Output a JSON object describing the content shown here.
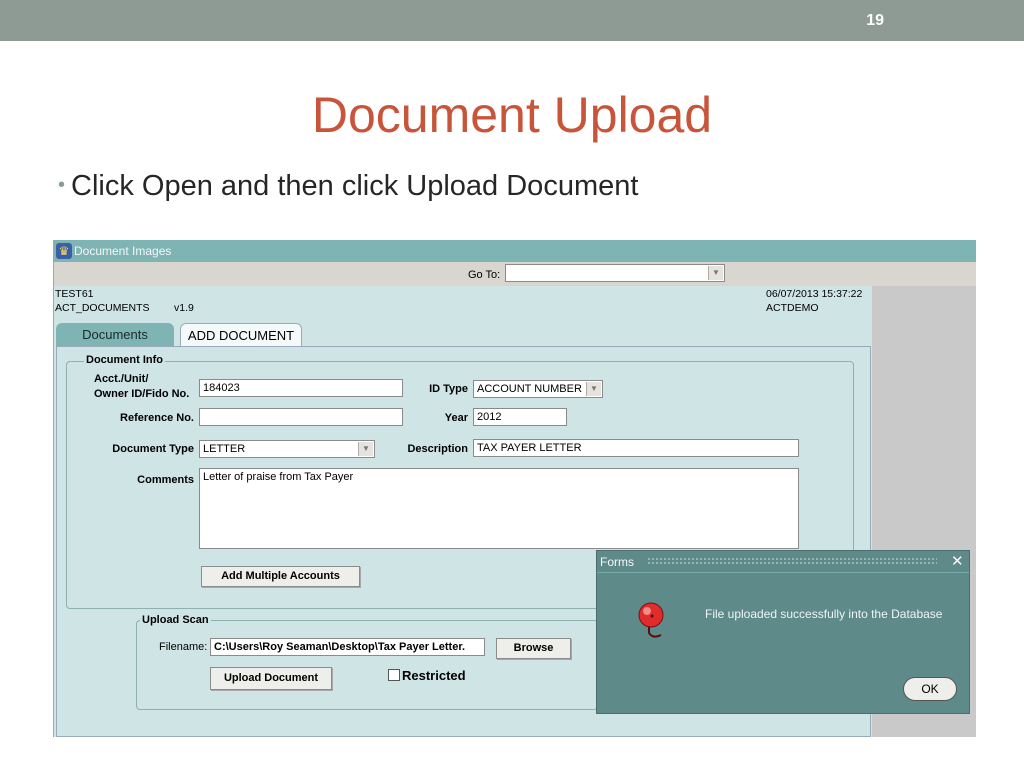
{
  "slide": {
    "number": "19",
    "title": "Document Upload",
    "bullet": "Click Open and then click Upload Document"
  },
  "window": {
    "title": "Document Images",
    "goto_label": "Go To:",
    "goto_value": "",
    "code_left_1": "TEST61",
    "code_left_2": "ACT_DOCUMENTS",
    "version": "v1.9",
    "datetime": "06/07/2013 15:37:22",
    "env": "ACTDEMO"
  },
  "tabs": {
    "documents": "Documents",
    "add_document": "ADD DOCUMENT"
  },
  "document_info": {
    "group_label": "Document Info",
    "acct_label_1": "Acct./Unit/",
    "acct_label_2": "Owner ID/Fido No.",
    "acct_value": "184023",
    "id_type_label": "ID Type",
    "id_type_value": "ACCOUNT NUMBER",
    "reference_label": "Reference No.",
    "reference_value": "",
    "year_label": "Year",
    "year_value": "2012",
    "doc_type_label": "Document Type",
    "doc_type_value": "LETTER",
    "description_label": "Description",
    "description_value": "TAX PAYER LETTER",
    "comments_label": "Comments",
    "comments_value": "Letter of praise from Tax Payer",
    "add_multiple_label": "Add Multiple Accounts"
  },
  "upload_scan": {
    "group_label": "Upload Scan",
    "filename_label": "Filename:",
    "filename_value": "C:\\Users\\Roy Seaman\\Desktop\\Tax Payer Letter.",
    "browse_label": "Browse",
    "upload_label": "Upload Document",
    "restricted_label": "Restricted",
    "restricted_checked": false
  },
  "dialog": {
    "title": "Forms",
    "message": "File uploaded successfully into the Database",
    "ok_label": "OK",
    "icon": "bell-icon"
  },
  "colors": {
    "title_red": "#c8553a",
    "teal": "#7fb4b4",
    "panel": "#cfe4e4",
    "dialog": "#5f8a8a"
  }
}
